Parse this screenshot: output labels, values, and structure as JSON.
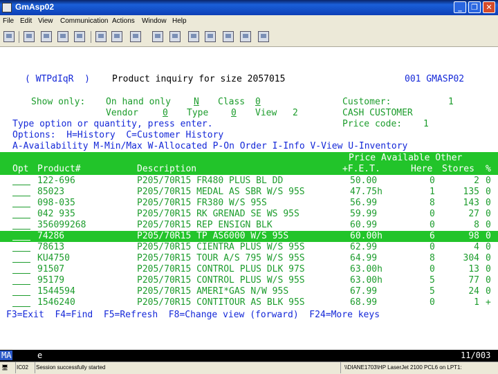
{
  "window": {
    "title": "GmAsp02"
  },
  "menu": [
    "File",
    "Edit",
    "View",
    "Communication",
    "Actions",
    "Window",
    "Help"
  ],
  "screen": {
    "header_left": "( WTPdIqR  )",
    "header_title": "Product inquiry for size 2057015",
    "header_right": "001 GMASP02",
    "show_only_label": "Show only:",
    "on_hand_label": "On hand only",
    "on_hand_value": "N",
    "class_label": "Class",
    "class_value": "0",
    "customer_label": "Customer:",
    "customer_value": "1",
    "vendor_label": "Vendor",
    "vendor_value": "0",
    "type_label": "Type",
    "type_value": "0",
    "view_label": "View",
    "view_value": "2",
    "customer_name": "CASH CUSTOMER",
    "type_option_text": "Type option or quantity, press enter.",
    "price_code_label": "Price code:",
    "price_code_value": "1",
    "options_line": "Options:  H=History  C=Customer History",
    "options_line2": "A-Availability M-Min/Max W-Allocated P-On Order I-Info V-View U-Inventory",
    "col_header_top": "Price Available Other",
    "col_opt": "Opt",
    "col_product": "Product#",
    "col_desc": "Description",
    "col_price": "+F.E.T.",
    "col_here": "Here",
    "col_stores": "Stores",
    "col_pct": "%",
    "rows": [
      {
        "product": "122-696",
        "desc": "P205/70R15 FR480 PLUS BL DD",
        "price": "50.00",
        "here": "0",
        "stores": "2",
        "pct": "0",
        "selected": false
      },
      {
        "product": "85023",
        "desc": "P205/70R15 MEDAL AS SBR W/S 95S",
        "price": "47.75h",
        "here": "1",
        "stores": "135",
        "pct": "0",
        "selected": false
      },
      {
        "product": "098-035",
        "desc": "P205/70R15 FR380 W/S 95S",
        "price": "56.99",
        "here": "8",
        "stores": "143",
        "pct": "0",
        "selected": false
      },
      {
        "product": "042 935",
        "desc": "P205/70R15 RK GRENAD SE WS 95S",
        "price": "59.99",
        "here": "0",
        "stores": "27",
        "pct": "0",
        "selected": false
      },
      {
        "product": "356099268",
        "desc": "P205/70R15 REP ENSIGN BLK",
        "price": "60.99",
        "here": "0",
        "stores": "8",
        "pct": "0",
        "selected": false
      },
      {
        "product": "74286",
        "desc": "P205/70R15 TP AS6000 W/S 95S",
        "price": "60.00h",
        "here": "6",
        "stores": "98",
        "pct": "0",
        "selected": true
      },
      {
        "product": "78613",
        "desc": "P205/70R15 CIENTRA PLUS W/S 95S",
        "price": "62.99",
        "here": "0",
        "stores": "4",
        "pct": "0",
        "selected": false
      },
      {
        "product": "KU4750",
        "desc": "P205/70R15 TOUR A/S 795 W/S 95S",
        "price": "64.99",
        "here": "8",
        "stores": "304",
        "pct": "0",
        "selected": false
      },
      {
        "product": "91507",
        "desc": "P205/70R15 CONTROL PLUS DLK 97S",
        "price": "63.00h",
        "here": "0",
        "stores": "13",
        "pct": "0",
        "selected": false
      },
      {
        "product": "95179",
        "desc": "P205/70R15 CONTROL PLUS W/S 95S",
        "price": "63.00h",
        "here": "5",
        "stores": "77",
        "pct": "0",
        "selected": false
      },
      {
        "product": "1544594",
        "desc": "P205/70R15 AMERI*GAS N/W 95S",
        "price": "67.99",
        "here": "5",
        "stores": "24",
        "pct": "0",
        "selected": false
      },
      {
        "product": "1546240",
        "desc": "P205/70R15 CONTITOUR AS BLK 95S",
        "price": "68.99",
        "here": "0",
        "stores": "1",
        "pct": "+",
        "selected": false
      }
    ],
    "fkeys": "F3=Exit  F4=Find  F5=Refresh  F8=Change view (forward)  F24=More keys"
  },
  "status_bar": {
    "mode": "MA",
    "indicator": "e",
    "position": "11/003"
  },
  "bottom_bar": {
    "session": "IC02",
    "message": "Session successfully started",
    "printer": "\\\\DIANE1703\\HP LaserJet 2100 PCL6 on LPT1:"
  }
}
